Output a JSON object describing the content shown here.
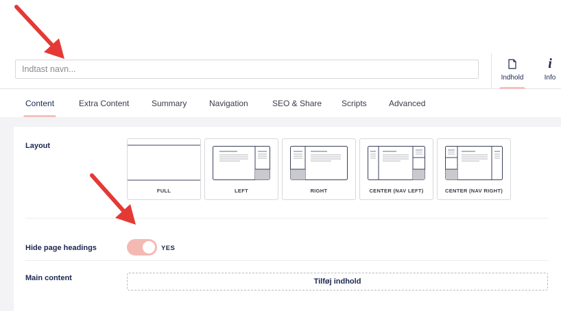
{
  "header": {
    "name_placeholder": "Indtast navn...",
    "name_value": "",
    "apps": [
      {
        "label": "Indhold",
        "icon": "document-icon",
        "active": true
      },
      {
        "label": "Info",
        "icon": "info-icon",
        "active": false
      }
    ]
  },
  "tabs": [
    {
      "label": "Content",
      "active": true
    },
    {
      "label": "Extra Content",
      "active": false
    },
    {
      "label": "Summary",
      "active": false
    },
    {
      "label": "Navigation",
      "active": false
    },
    {
      "label": "SEO & Share",
      "active": false
    },
    {
      "label": "Scripts",
      "active": false
    },
    {
      "label": "Advanced",
      "active": false
    }
  ],
  "properties": {
    "layout": {
      "label": "Layout",
      "options": [
        "FULL",
        "LEFT",
        "RIGHT",
        "CENTER (NAV LEFT)",
        "CENTER (NAV RIGHT)"
      ]
    },
    "hide_headings": {
      "label": "Hide page headings",
      "value_label": "YES",
      "checked": true
    },
    "main_content": {
      "label": "Main content",
      "add_label": "Tilføj indhold"
    }
  },
  "colors": {
    "accent": "#f5c1bc",
    "toggle": "#f5b9b3",
    "text": "#1b264f",
    "arrow": "#e53935",
    "background": "#f3f3f5"
  }
}
